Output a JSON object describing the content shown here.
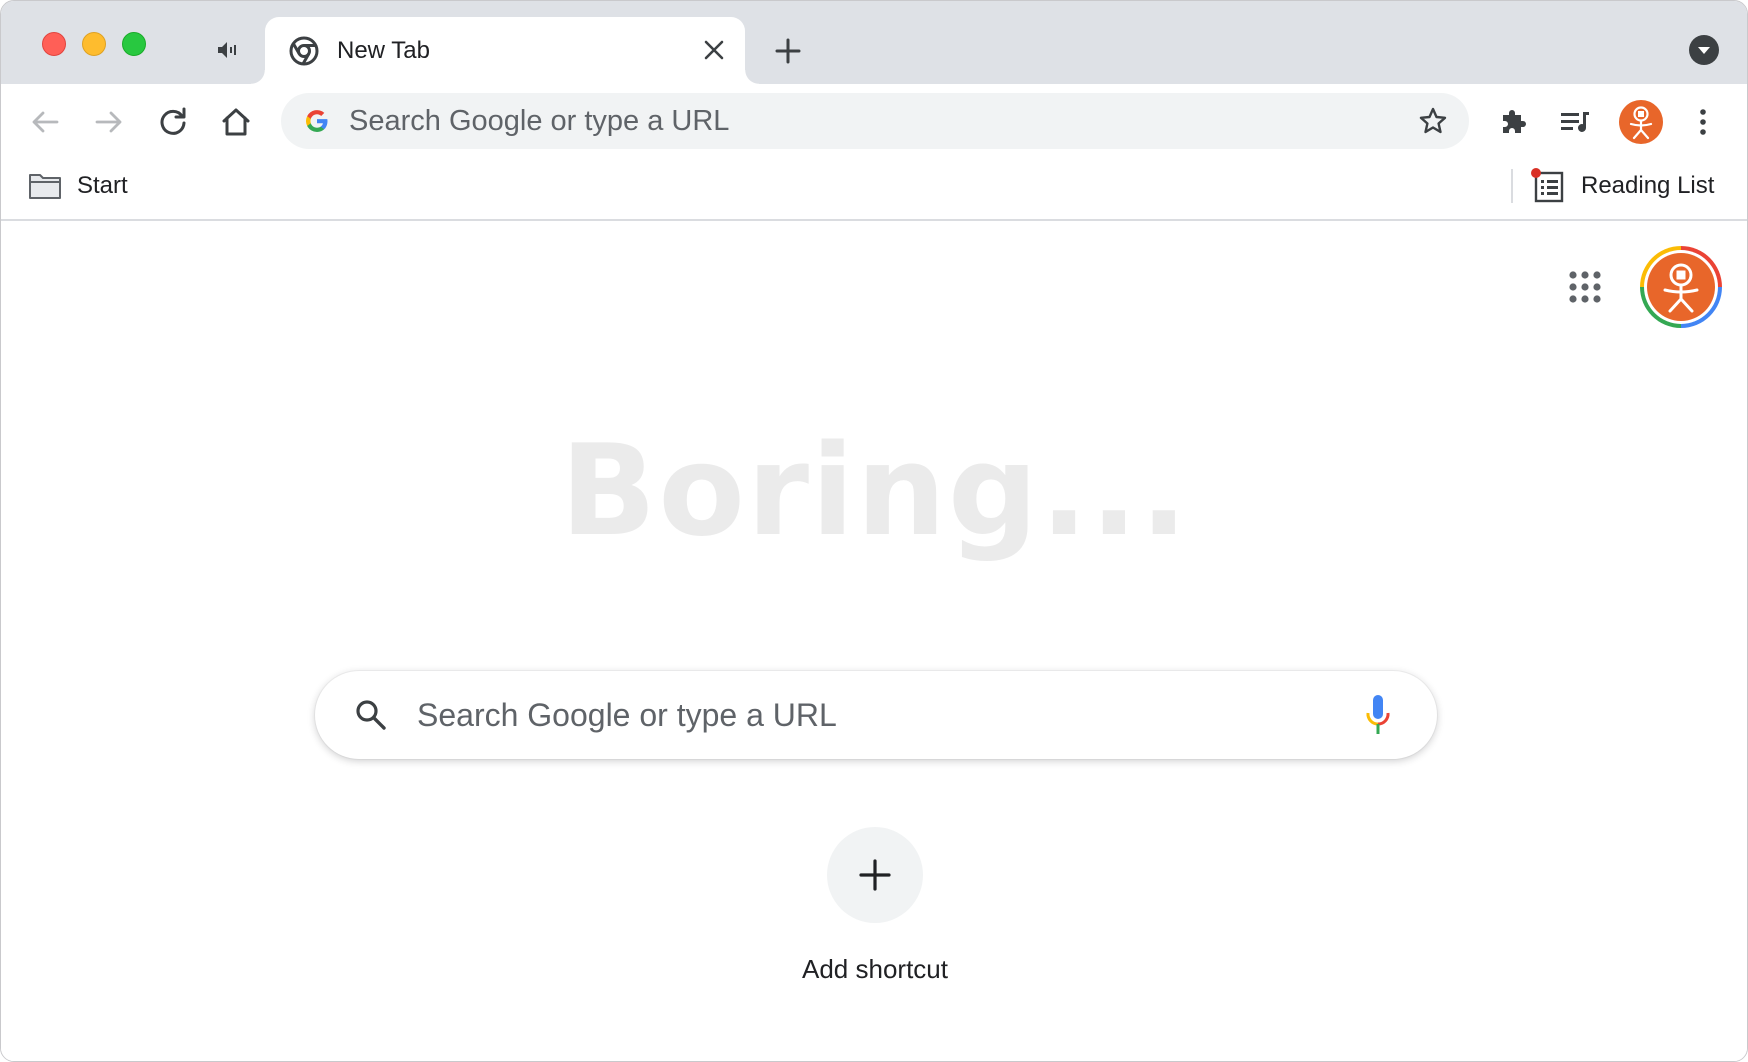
{
  "window": {
    "controls": [
      "close",
      "minimize",
      "maximize"
    ]
  },
  "tab": {
    "title": "New Tab",
    "favicon": "chrome-icon",
    "audio_icon": "speaker-icon"
  },
  "toolbar": {
    "icons": [
      "back-arrow-icon",
      "forward-arrow-icon",
      "reload-icon",
      "home-icon",
      "puzzle-icon",
      "media-queue-icon",
      "kebab-menu-icon"
    ]
  },
  "omnibox": {
    "placeholder": "Search Google or type a URL",
    "icon": "google-g-icon",
    "star_icon": "star-outline-icon"
  },
  "bookmarks": {
    "items": [
      {
        "label": "Start",
        "icon": "folder-icon"
      }
    ],
    "reading_list": {
      "label": "Reading List",
      "icon": "reading-list-icon",
      "has_notification": true
    }
  },
  "content": {
    "doodle_text": "Boring...",
    "search": {
      "placeholder": "Search Google or type a URL"
    },
    "shortcut": {
      "label": "Add shortcut"
    }
  },
  "colors": {
    "tabstrip": "#dee1e6",
    "avatar": "#e8662a",
    "omnibox_bg": "#f1f3f4",
    "text_muted": "#5f6368",
    "notification_dot": "#d93025"
  }
}
